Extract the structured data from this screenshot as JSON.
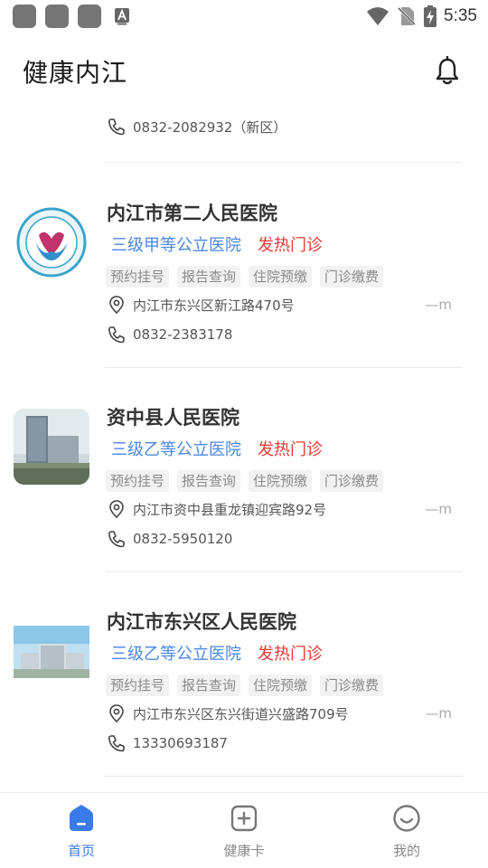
{
  "status_bar": {
    "time": "5:35"
  },
  "header": {
    "title": "健康内江"
  },
  "partial_item": {
    "phone": "0832-2082932（新区）"
  },
  "hospitals": [
    {
      "name": "内江市第二人民医院",
      "grade": "三级甲等公立医院",
      "fever_clinic": "发热门诊",
      "services": [
        "预约挂号",
        "报告查询",
        "住院预缴",
        "门诊缴费"
      ],
      "address": "内江市东兴区新江路470号",
      "distance": "—m",
      "phone": "0832-2383178"
    },
    {
      "name": "资中县人民医院",
      "grade": "三级乙等公立医院",
      "fever_clinic": "发热门诊",
      "services": [
        "预约挂号",
        "报告查询",
        "住院预缴",
        "门诊缴费"
      ],
      "address": "内江市资中县重龙镇迎宾路92号",
      "distance": "—m",
      "phone": "0832-5950120"
    },
    {
      "name": "内江市东兴区人民医院",
      "grade": "三级乙等公立医院",
      "fever_clinic": "发热门诊",
      "services": [
        "预约挂号",
        "报告查询",
        "住院预缴",
        "门诊缴费"
      ],
      "address": "内江市东兴区东兴街道兴盛路709号",
      "distance": "—m",
      "phone": "13330693187"
    }
  ],
  "nav": {
    "items": [
      {
        "label": "首页",
        "icon": "home-icon",
        "active": true
      },
      {
        "label": "健康卡",
        "icon": "health-card-icon",
        "active": false
      },
      {
        "label": "我的",
        "icon": "profile-icon",
        "active": false
      }
    ]
  },
  "colors": {
    "accent": "#3a7bea",
    "grade": "#4a86e8",
    "fever": "#e53935"
  }
}
